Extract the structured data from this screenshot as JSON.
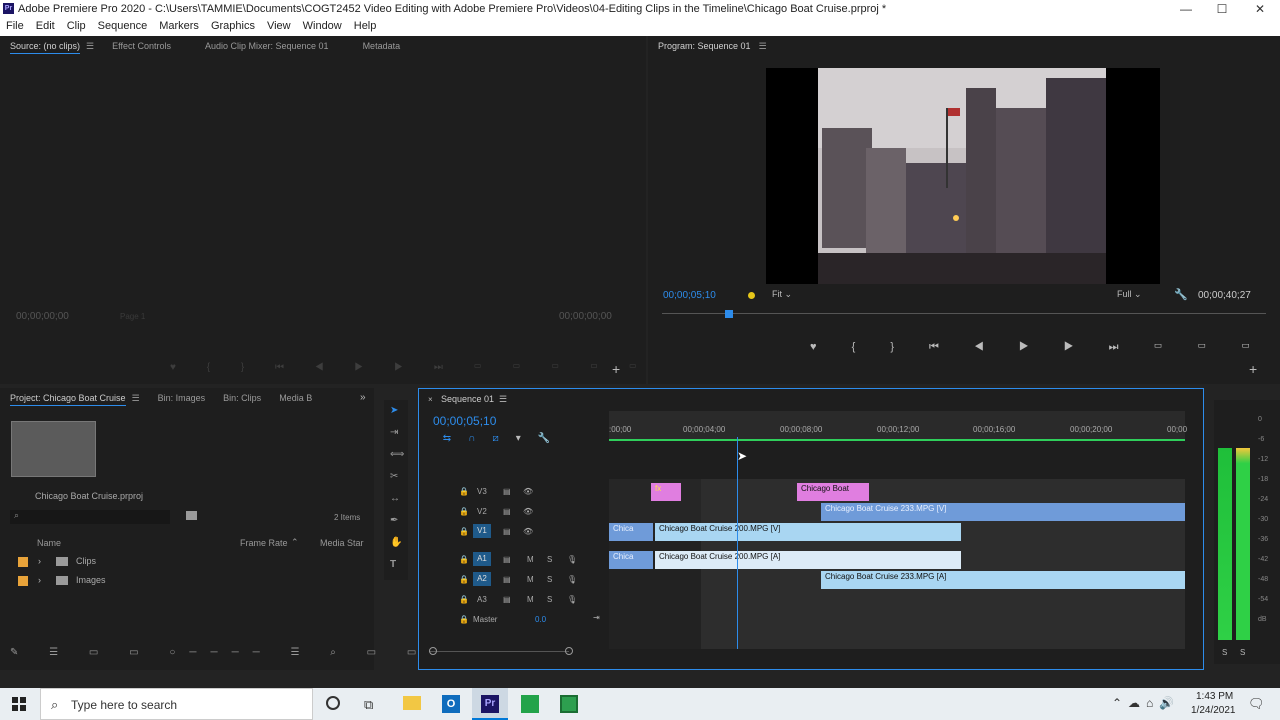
{
  "titlebar": {
    "title": "Adobe Premiere Pro 2020 - C:\\Users\\TAMMIE\\Documents\\COGT2452 Video Editing with Adobe Premiere Pro\\Videos\\04-Editing Clips in the Timeline\\Chicago Boat Cruise.prproj *",
    "minimize": "—",
    "maximize": "☐",
    "close": "✕"
  },
  "menu": [
    "File",
    "Edit",
    "Clip",
    "Sequence",
    "Markers",
    "Graphics",
    "View",
    "Window",
    "Help"
  ],
  "source_panel": {
    "tabs": [
      "Source: (no clips)",
      "Effect Controls",
      "Audio Clip Mixer: Sequence 01",
      "Metadata"
    ],
    "timecode_left": "00;00;00;00",
    "page_label": "Page 1",
    "timecode_right": "00;00;00;00"
  },
  "program_panel": {
    "title": "Program: Sequence 01",
    "timecode": "00;00;05;10",
    "fit": "Fit",
    "quality": "Full",
    "duration": "00;00;40;27"
  },
  "project_panel": {
    "tabs": [
      "Project: Chicago Boat Cruise",
      "Bin: Images",
      "Bin: Clips",
      "Media B"
    ],
    "project_file": "Chicago Boat Cruise.prproj",
    "item_count": "2 Items",
    "columns": [
      "Name",
      "Frame Rate",
      "Media Star"
    ],
    "items": [
      {
        "name": "Clips",
        "color": "#e8a33a"
      },
      {
        "name": "Images",
        "color": "#e8a33a"
      }
    ]
  },
  "timeline": {
    "tab": "Sequence 01",
    "timecode": "00;00;05;10",
    "ruler": [
      ":00;00",
      "00;00;04;00",
      "00;00;08;00",
      "00;00;12;00",
      "00;00;16;00",
      "00;00;20;00",
      "00;00"
    ],
    "video_tracks": [
      "V3",
      "V2",
      "V1"
    ],
    "audio_tracks": [
      "A1",
      "A2",
      "A3"
    ],
    "master_label": "Master",
    "master_value": "0.0",
    "mute_label": "M",
    "solo_label": "S",
    "clips": {
      "v3_fx": "fx",
      "v3_title": "Chicago Boat",
      "v2": "Chicago Boat Cruise 233.MPG [V]",
      "v1_a": "Chica",
      "v1_b": "Chicago Boat Cruise 200.MPG [V]",
      "a1_a": "Chica",
      "a1_b": "Chicago Boat Cruise 200.MPG [A]",
      "a2": "Chicago Boat Cruise 233.MPG [A]"
    }
  },
  "meter": {
    "labels": [
      "0",
      "-6",
      "-12",
      "-18",
      "-24",
      "-30",
      "-36",
      "-42",
      "-48",
      "-54",
      "dB"
    ],
    "solo": "S",
    "solo2": "S"
  },
  "taskbar": {
    "search_placeholder": "Type here to search",
    "time": "1:43 PM",
    "date": "1/24/2021"
  }
}
